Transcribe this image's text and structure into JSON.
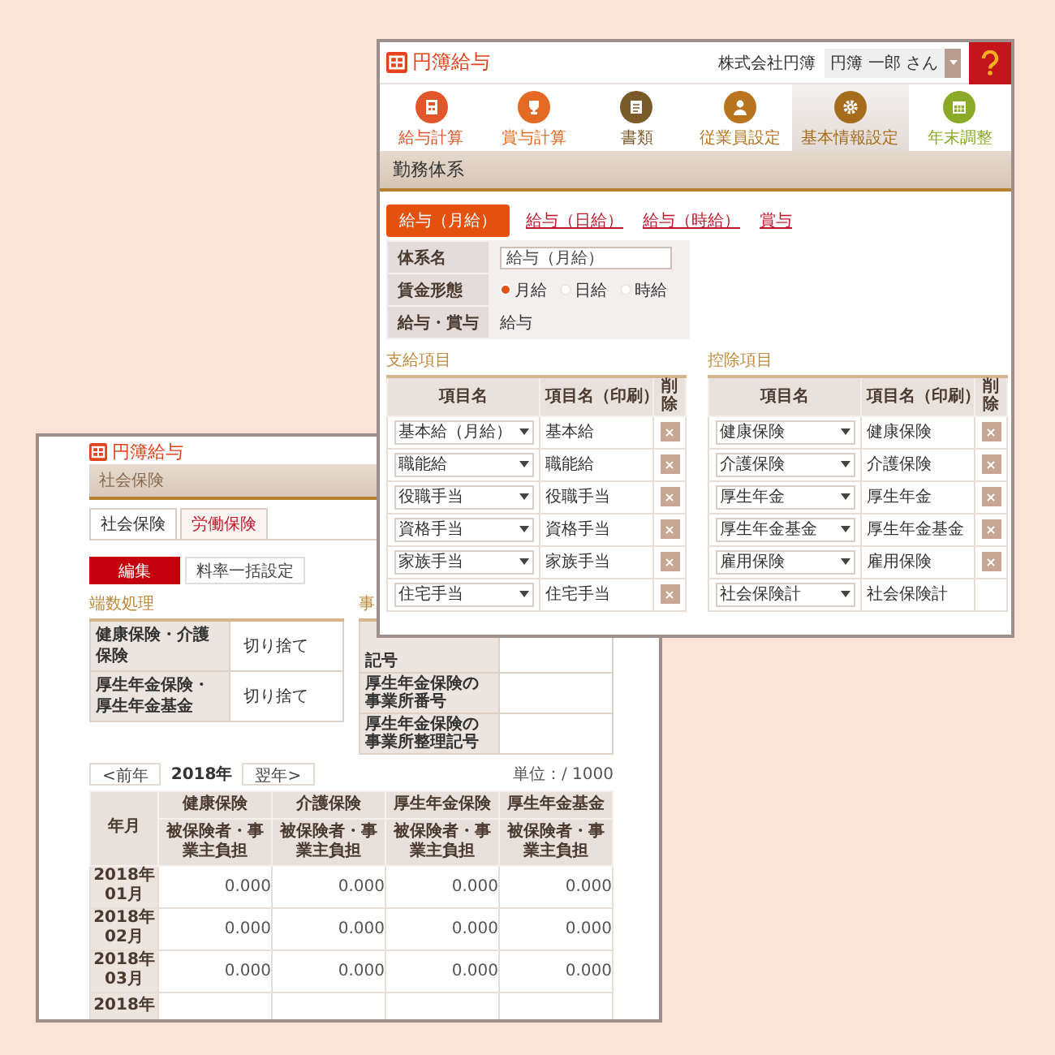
{
  "back_window": {
    "logo": "円簿給与",
    "section_title": "社会保険",
    "tabs": [
      {
        "label": "社会保険",
        "selected": true
      },
      {
        "label": "労働保険",
        "selected": false
      }
    ],
    "buttons": [
      {
        "label": "編集",
        "kind": "primary"
      },
      {
        "label": "料率一括設定",
        "kind": "secondary"
      }
    ],
    "rounding": {
      "title": "端数処理",
      "rows": [
        {
          "label": "健康保険・介護保険",
          "value": "切り捨て"
        },
        {
          "label": "厚生年金保険・厚生年金基金",
          "value": "切り捨て"
        }
      ]
    },
    "office": {
      "title": "事",
      "rows": [
        {
          "label": "記号"
        },
        {
          "label": "厚生年金保険の事業所番号"
        },
        {
          "label": "厚生年金保険の事業所整理記号"
        }
      ]
    },
    "year_nav": {
      "prev": "<前年",
      "year": "2018年",
      "next": "翌年>"
    },
    "unit": "単位：/ 1000",
    "table": {
      "corner": "年月",
      "groups": [
        "健康保険",
        "介護保険",
        "厚生年金保険",
        "厚生年金基金"
      ],
      "subheaders": [
        "被保険者・事業主負担",
        "被保険者・事業主負担",
        "被保険者・事業主負担",
        "被保険者・事業主負担"
      ],
      "rows": [
        {
          "year": "2018年",
          "month": "01月",
          "values": [
            "0.000",
            "0.000",
            "0.000",
            "0.000"
          ]
        },
        {
          "year": "2018年",
          "month": "02月",
          "values": [
            "0.000",
            "0.000",
            "0.000",
            "0.000"
          ]
        },
        {
          "year": "2018年",
          "month": "03月",
          "values": [
            "0.000",
            "0.000",
            "0.000",
            "0.000"
          ]
        },
        {
          "year": "2018年"
        }
      ]
    }
  },
  "front_window": {
    "logo": "円簿給与",
    "company": "株式会社円簿",
    "user": "円簿 一郎 さん",
    "nav": [
      {
        "label": "給与計算",
        "color": "#e2572b",
        "selected": false
      },
      {
        "label": "賞与計算",
        "color": "#e46a24",
        "selected": false
      },
      {
        "label": "書類",
        "color": "#7a5a28",
        "selected": false
      },
      {
        "label": "従業員設定",
        "color": "#b8741e",
        "selected": false
      },
      {
        "label": "基本情報設定",
        "color": "#a46c1c",
        "selected": true
      },
      {
        "label": "年末調整",
        "color": "#8aaa28",
        "selected": false
      }
    ],
    "section_title": "勤務体系",
    "tabs": [
      {
        "label": "給与（月給）",
        "selected": true
      },
      {
        "label": "給与（日給）",
        "selected": false
      },
      {
        "label": "給与（時給）",
        "selected": false
      },
      {
        "label": "賞与",
        "selected": false
      }
    ],
    "form": {
      "rows": [
        {
          "kind": "input",
          "label": "体系名",
          "value": "給与（月給）"
        },
        {
          "kind": "radio",
          "label": "賃金形態",
          "options": [
            {
              "label": "月給",
              "selected": true
            },
            {
              "label": "日給",
              "selected": false
            },
            {
              "label": "時給",
              "selected": false
            }
          ]
        },
        {
          "kind": "text",
          "label": "給与・賞与",
          "value": "給与"
        }
      ]
    },
    "payments": {
      "title": "支給項目",
      "columns": [
        "項目名",
        "項目名（印刷）",
        "削除"
      ],
      "rows": [
        {
          "item": "基本給（月給）",
          "print_name": "基本給",
          "deletable": true
        },
        {
          "item": "職能給",
          "print_name": "職能給",
          "deletable": true
        },
        {
          "item": "役職手当",
          "print_name": "役職手当",
          "deletable": true
        },
        {
          "item": "資格手当",
          "print_name": "資格手当",
          "deletable": true
        },
        {
          "item": "家族手当",
          "print_name": "家族手当",
          "deletable": true
        },
        {
          "item": "住宅手当",
          "print_name": "住宅手当",
          "deletable": true
        }
      ]
    },
    "deductions": {
      "title": "控除項目",
      "columns": [
        "項目名",
        "項目名（印刷）",
        "削除"
      ],
      "rows": [
        {
          "item": "健康保険",
          "print_name": "健康保険",
          "deletable": true
        },
        {
          "item": "介護保険",
          "print_name": "介護保険",
          "deletable": true
        },
        {
          "item": "厚生年金",
          "print_name": "厚生年金",
          "deletable": true
        },
        {
          "item": "厚生年金基金",
          "print_name": "厚生年金基金",
          "deletable": true
        },
        {
          "item": "雇用保険",
          "print_name": "雇用保険",
          "deletable": true
        },
        {
          "item": "社会保険計",
          "print_name": "社会保険計",
          "deletable": false
        }
      ]
    }
  }
}
